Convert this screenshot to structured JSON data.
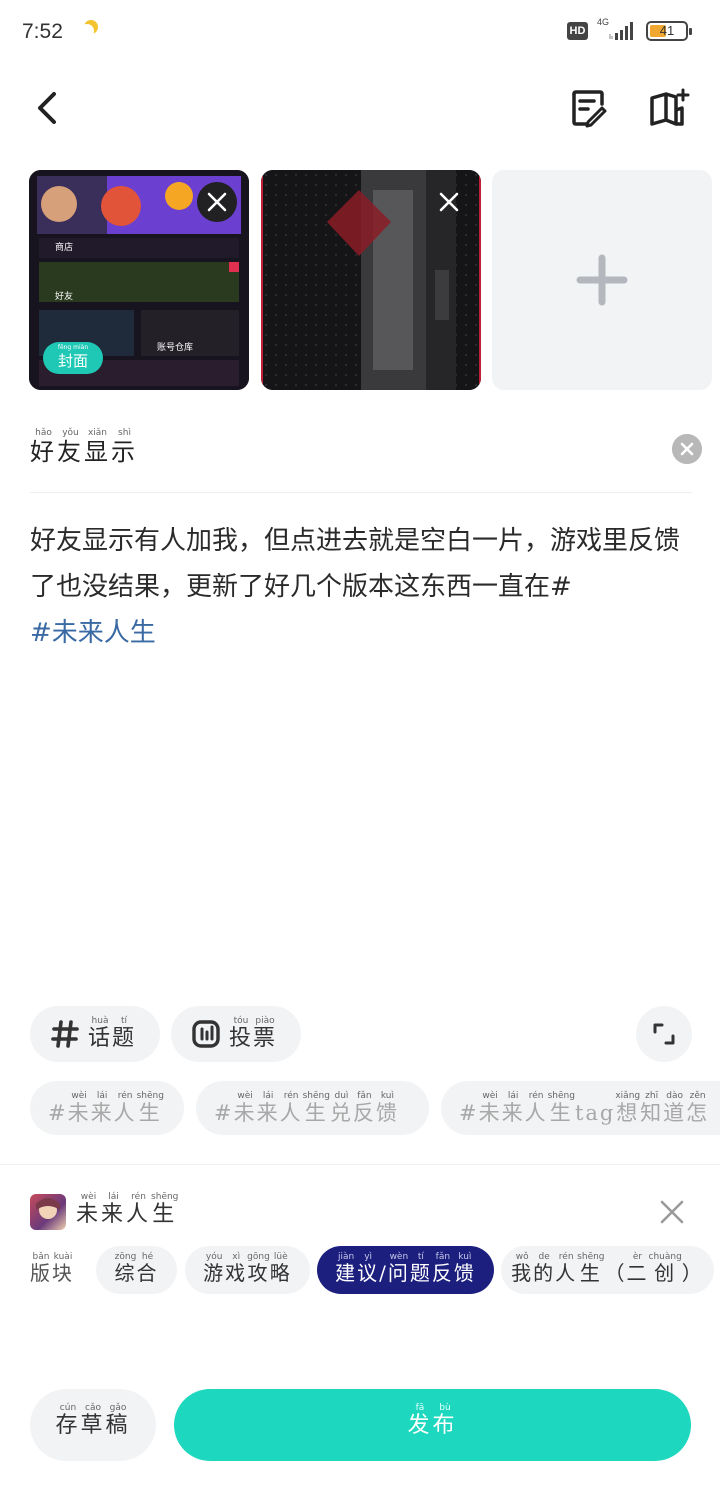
{
  "status_bar": {
    "time": "7:52",
    "hd": "HD",
    "network": "4G",
    "battery": "41"
  },
  "header": {
    "back_icon": "chevron-left-icon",
    "draft_box_icon": "draft-edit-icon",
    "add_page_icon": "book-plus-icon"
  },
  "images": {
    "cover_badge": {
      "ruby": [
        "fēng",
        "miàn"
      ],
      "text": [
        "封",
        "面"
      ]
    },
    "add_icon": "plus-icon"
  },
  "title": {
    "chars": [
      "好",
      "友",
      "显",
      "示"
    ],
    "pinyin": [
      "hǎo",
      "yǒu",
      "xiǎn",
      "shì"
    ]
  },
  "body": {
    "text": "好友显示有人加我，但点进去就是空白一片，游戏里反馈了也没结果，更新了好几个版本这东西一直在#",
    "tag": "#未来人生"
  },
  "tools": {
    "topic": {
      "chars": [
        "话",
        "题"
      ],
      "pinyin": [
        "huà",
        "tí"
      ]
    },
    "poll": {
      "chars": [
        "投",
        "票"
      ],
      "pinyin": [
        "tóu",
        "piào"
      ]
    }
  },
  "suggestions": [
    {
      "chars": [
        "#",
        "未",
        "来",
        "人",
        "生"
      ],
      "pinyin": [
        "",
        "wèi",
        "lái",
        "rén",
        "shēng"
      ]
    },
    {
      "chars": [
        "#",
        "未",
        "来",
        "人",
        "生",
        "兑",
        "反",
        "馈"
      ],
      "pinyin": [
        "",
        "wèi",
        "lái",
        "rén",
        "shēng",
        "duì",
        "fǎn",
        "kuì"
      ]
    },
    {
      "chars": [
        "#",
        "未",
        "来",
        "人",
        "生",
        "tag",
        "想",
        "知",
        "道",
        "怎"
      ],
      "pinyin": [
        "",
        "wèi",
        "lái",
        "rén",
        "shēng",
        "",
        "xiǎng",
        "zhī",
        "dào",
        "zěn"
      ]
    }
  ],
  "game": {
    "chars": [
      "未",
      "来",
      "人",
      "生"
    ],
    "pinyin": [
      "wèi",
      "lái",
      "rén",
      "shēng"
    ]
  },
  "board": {
    "label": {
      "chars": [
        "版",
        "块"
      ],
      "pinyin": [
        "bǎn",
        "kuài"
      ]
    },
    "tabs": [
      {
        "chars": [
          "综",
          "合"
        ],
        "pinyin": [
          "zōng",
          "hé"
        ],
        "active": false
      },
      {
        "chars": [
          "游",
          "戏",
          "攻",
          "略"
        ],
        "pinyin": [
          "yóu",
          "xì",
          "gōng",
          "lüè"
        ],
        "active": false
      },
      {
        "chars": [
          "建",
          "议",
          "/",
          "问",
          "题",
          "反",
          "馈"
        ],
        "pinyin": [
          "jiàn",
          "yì",
          "",
          "wèn",
          "tí",
          "fǎn",
          "kuì"
        ],
        "active": true
      },
      {
        "chars": [
          "我",
          "的",
          "人",
          "生",
          "（",
          "二",
          "创",
          "）"
        ],
        "pinyin": [
          "wǒ",
          "de",
          "rén",
          "shēng",
          "",
          "èr",
          "chuàng",
          ""
        ],
        "active": false
      }
    ]
  },
  "bottom": {
    "draft": {
      "chars": [
        "存",
        "草",
        "稿"
      ],
      "pinyin": [
        "cún",
        "cǎo",
        "gǎo"
      ]
    },
    "publish": {
      "chars": [
        "发",
        "布"
      ],
      "pinyin": [
        "fā",
        "bù"
      ]
    }
  },
  "colors": {
    "accent": "#1ed7bf",
    "active_tab": "#1c1f7e",
    "tag": "#3a6aa4",
    "pill_bg": "#f2f3f5"
  }
}
